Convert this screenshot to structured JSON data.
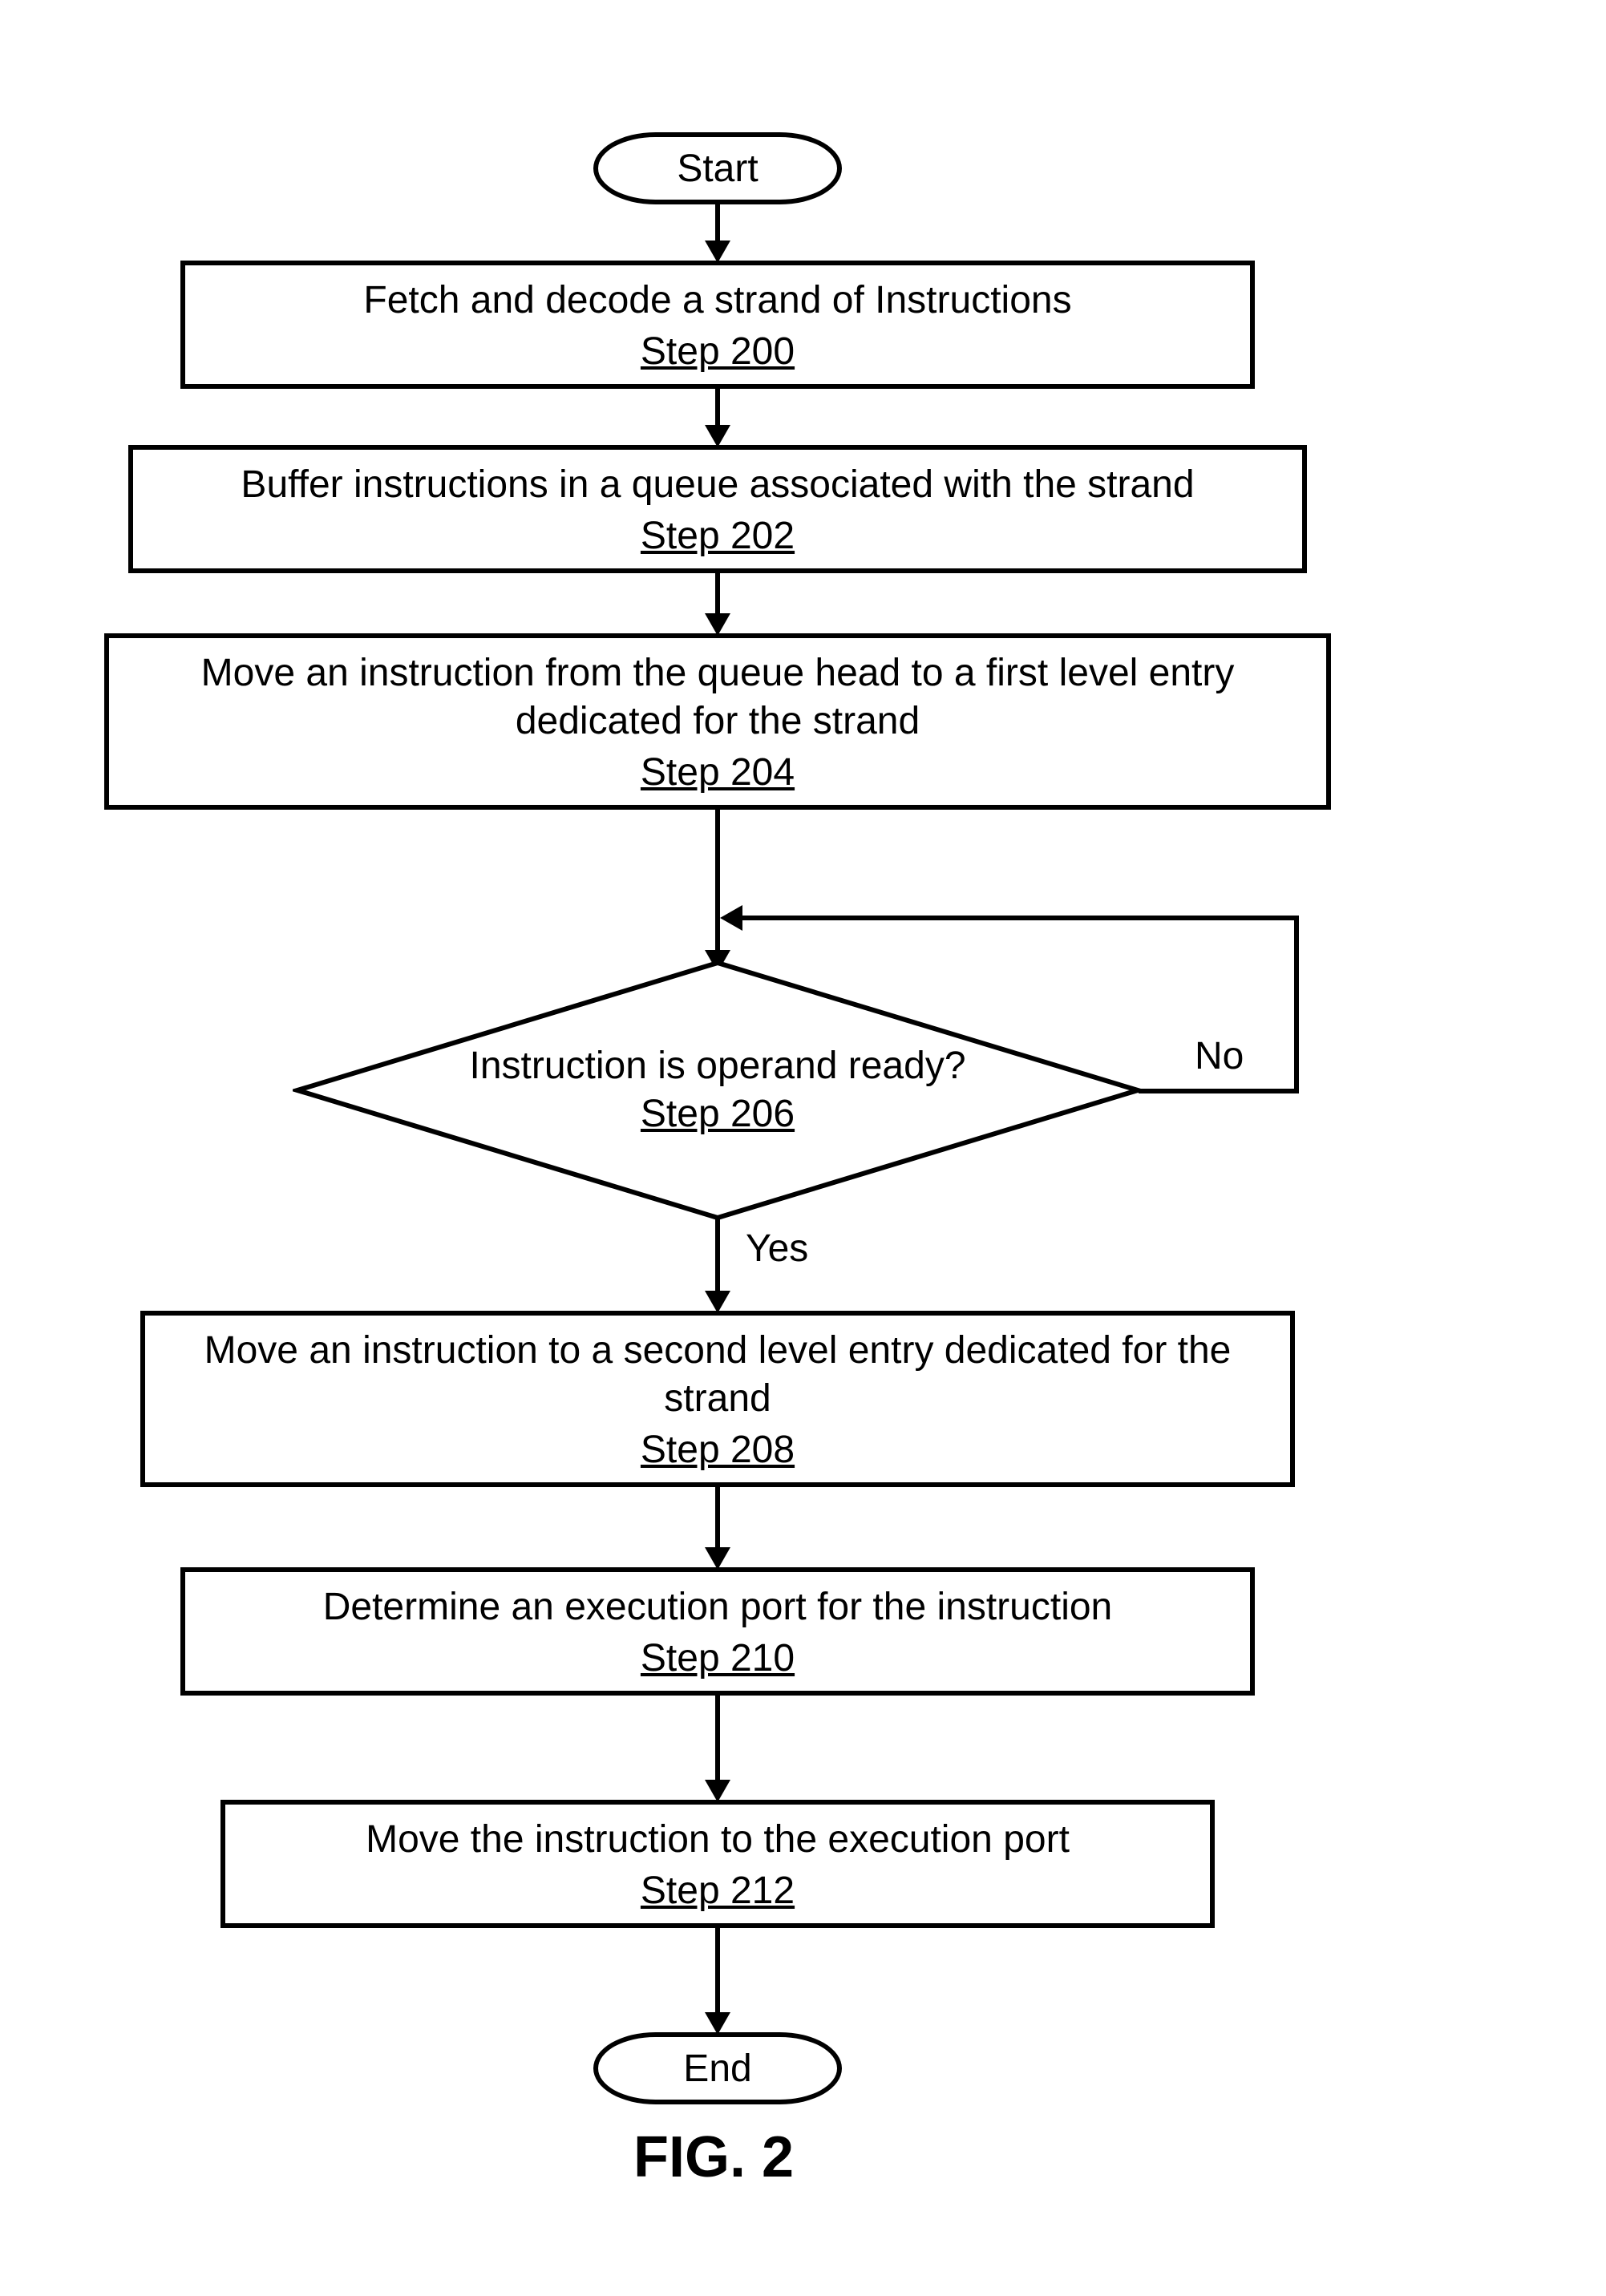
{
  "chart_data": {
    "type": "flowchart",
    "title": "FIG. 2",
    "nodes": [
      {
        "id": "start",
        "type": "terminator",
        "label": "Start"
      },
      {
        "id": "s200",
        "type": "process",
        "label": "Fetch and decode a strand of Instructions",
        "step": "Step 200"
      },
      {
        "id": "s202",
        "type": "process",
        "label": "Buffer instructions in a queue associated with the strand",
        "step": "Step 202"
      },
      {
        "id": "s204",
        "type": "process",
        "label": "Move an instruction from the queue head to a first level entry dedicated for the strand",
        "step": "Step 204"
      },
      {
        "id": "s206",
        "type": "decision",
        "label": "Instruction is operand ready?",
        "step": "Step 206"
      },
      {
        "id": "s208",
        "type": "process",
        "label": "Move an instruction to a second level entry dedicated for the strand",
        "step": "Step 208"
      },
      {
        "id": "s210",
        "type": "process",
        "label": "Determine an execution port for the instruction",
        "step": "Step 210"
      },
      {
        "id": "s212",
        "type": "process",
        "label": "Move the instruction to the execution port",
        "step": "Step 212"
      },
      {
        "id": "end",
        "type": "terminator",
        "label": "End"
      }
    ],
    "edges": [
      {
        "from": "start",
        "to": "s200"
      },
      {
        "from": "s200",
        "to": "s202"
      },
      {
        "from": "s202",
        "to": "s204"
      },
      {
        "from": "s204",
        "to": "s206"
      },
      {
        "from": "s206",
        "to": "s208",
        "label": "Yes"
      },
      {
        "from": "s206",
        "to": "s206",
        "label": "No"
      },
      {
        "from": "s208",
        "to": "s210"
      },
      {
        "from": "s210",
        "to": "s212"
      },
      {
        "from": "s212",
        "to": "end"
      }
    ]
  },
  "terminator_start": "Start",
  "terminator_end": "End",
  "s200_label": "Fetch and decode a strand of Instructions",
  "s200_step": "Step 200",
  "s202_label": "Buffer instructions in a queue associated with the strand",
  "s202_step": "Step 202",
  "s204_label": "Move an instruction from the queue head to a first level entry dedicated for the strand",
  "s204_step": "Step 204",
  "s206_label": "Instruction is operand ready?",
  "s206_step": "Step 206",
  "s208_label": "Move an instruction to a second level entry dedicated for the strand",
  "s208_step": "Step 208",
  "s210_label": "Determine an execution port for the instruction",
  "s210_step": "Step 210",
  "s212_label": "Move the instruction to the execution port",
  "s212_step": "Step 212",
  "yes_label": "Yes",
  "no_label": "No",
  "caption": "FIG. 2"
}
